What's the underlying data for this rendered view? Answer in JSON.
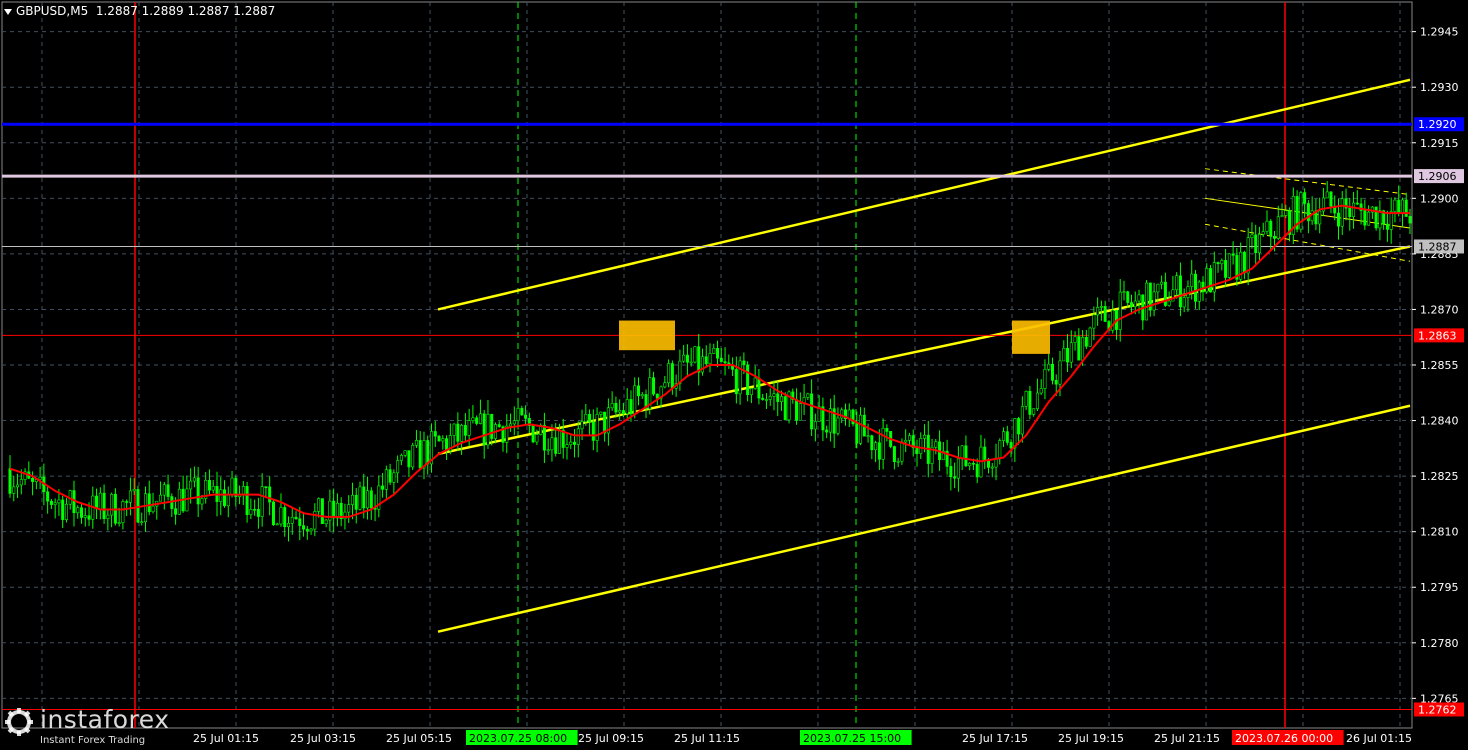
{
  "header": {
    "symbol": "GBPUSD,M5",
    "ohlc": "1.2887 1.2889 1.2887 1.2887"
  },
  "logo": {
    "name": "instaforex",
    "tagline": "Instant Forex Trading"
  },
  "colors": {
    "background": "#000000",
    "candles": "#00ff00",
    "ma": "#ff0000",
    "channel": "#ffff00",
    "level_blue": "#0000ff",
    "level_pink": "#e0c8e0",
    "grid": "#3f4f5f",
    "signal_box": "#ffc000",
    "vline_red": "#ff0000",
    "vline_session": "#00ff00",
    "axis_text": "#ffffff"
  },
  "chart_data": {
    "type": "line",
    "title": "GBPUSD,M5",
    "ylim": [
      1.2757,
      1.2953
    ],
    "grid": true,
    "y_ticks": [
      "1.2945",
      "1.2930",
      "1.2915",
      "1.2900",
      "1.2885",
      "1.2870",
      "1.2855",
      "1.2840",
      "1.2825",
      "1.2810",
      "1.2795",
      "1.2780",
      "1.2765"
    ],
    "x_ticks": [
      "25 Jul 01:15",
      "25 Jul 03:15",
      "25 Jul 05:15",
      "2023.07.25 08:00",
      "25 Jul 09:15",
      "25 Jul 11:15",
      "2023.07.25 15:00",
      "25 Jul 17:15",
      "25 Jul 19:15",
      "25 Jul 21:15",
      "2023.07.26 00:00",
      "26 Jul 01:15"
    ],
    "horizontal_levels": [
      {
        "value": 1.292,
        "label": "1.2920",
        "color": "#0000ff"
      },
      {
        "value": 1.2906,
        "label": "1.2906",
        "color": "#e0c8e0"
      },
      {
        "value": 1.2887,
        "label": "1.2887",
        "color": "#c0c0c0"
      },
      {
        "value": 1.2863,
        "label": "1.2863",
        "color": "#ff0000"
      },
      {
        "value": 1.2762,
        "label": "1.2762",
        "color": "#ff0000"
      }
    ],
    "series": [
      {
        "values": [
          [
            0,
            1.2827
          ],
          [
            6,
            1.2825
          ],
          [
            12,
            1.2821
          ],
          [
            18,
            1.2818
          ],
          [
            24,
            1.2816
          ],
          [
            30,
            1.2816
          ],
          [
            36,
            1.2817
          ],
          [
            42,
            1.2818
          ],
          [
            48,
            1.2819
          ],
          [
            54,
            1.282
          ],
          [
            60,
            1.282
          ],
          [
            66,
            1.282
          ],
          [
            72,
            1.2818
          ],
          [
            78,
            1.2815
          ],
          [
            84,
            1.2814
          ],
          [
            90,
            1.2814
          ],
          [
            96,
            1.2816
          ],
          [
            102,
            1.282
          ],
          [
            108,
            1.2826
          ],
          [
            114,
            1.2831
          ],
          [
            120,
            1.2834
          ],
          [
            126,
            1.2836
          ],
          [
            132,
            1.2838
          ],
          [
            138,
            1.2839
          ],
          [
            144,
            1.2838
          ],
          [
            150,
            1.2836
          ],
          [
            156,
            1.2836
          ],
          [
            162,
            1.2839
          ],
          [
            168,
            1.2843
          ],
          [
            174,
            1.2847
          ],
          [
            180,
            1.2852
          ],
          [
            186,
            1.2855
          ],
          [
            192,
            1.2855
          ],
          [
            198,
            1.2852
          ],
          [
            204,
            1.2848
          ],
          [
            210,
            1.2845
          ],
          [
            216,
            1.2843
          ],
          [
            222,
            1.2841
          ],
          [
            228,
            1.2838
          ],
          [
            234,
            1.2835
          ],
          [
            240,
            1.2833
          ],
          [
            246,
            1.2832
          ],
          [
            252,
            1.283
          ],
          [
            258,
            1.2829
          ],
          [
            264,
            1.283
          ],
          [
            270,
            1.2836
          ],
          [
            276,
            1.2845
          ],
          [
            282,
            1.2852
          ],
          [
            288,
            1.286
          ],
          [
            294,
            1.2867
          ],
          [
            300,
            1.287
          ],
          [
            306,
            1.2872
          ],
          [
            312,
            1.2874
          ],
          [
            318,
            1.2876
          ],
          [
            324,
            1.2878
          ],
          [
            330,
            1.2881
          ],
          [
            336,
            1.2887
          ],
          [
            342,
            1.2893
          ],
          [
            348,
            1.2897
          ],
          [
            354,
            1.2898
          ],
          [
            360,
            1.2897
          ],
          [
            366,
            1.2896
          ],
          [
            372,
            1.2896
          ]
        ]
      }
    ],
    "candles_approx": "green M5 candles tracking the moving average from 1.2827 to 1.2895",
    "channel": {
      "upper": {
        "from": [
          1.287
        ],
        "to": [
          1.2932
        ]
      },
      "middle": {
        "from": [
          1.2831
        ],
        "to": [
          1.2887
        ]
      },
      "lower": {
        "from": [
          1.2783
        ],
        "to": [
          1.2844
        ]
      },
      "short_channel": {
        "upper_from": 1.2908,
        "upper_to": 1.2901,
        "lower_from": 1.2893,
        "lower_to": 1.2883
      }
    },
    "signal_boxes": [
      {
        "from": 1.2859,
        "to": 1.2867
      },
      {
        "from": 1.2858,
        "to": 1.2867
      }
    ]
  }
}
